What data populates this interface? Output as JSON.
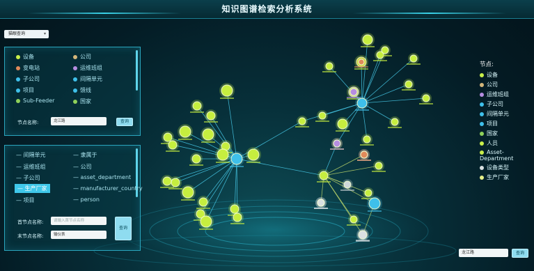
{
  "header": {
    "title": "知识图谱检索分析系统"
  },
  "mode_select": {
    "value": "猫眼查询"
  },
  "legend_panel": {
    "items": [
      {
        "label": "设备",
        "color": "#c9ef4a"
      },
      {
        "label": "公司",
        "color": "#d3b67a"
      },
      {
        "label": "变电站",
        "color": "#e08a5a"
      },
      {
        "label": "运维班组",
        "color": "#b58de0"
      },
      {
        "label": "子公司",
        "color": "#3fc0ea"
      },
      {
        "label": "间隔单元",
        "color": "#3fc0ea"
      },
      {
        "label": "项目",
        "color": "#3fc0ea"
      },
      {
        "label": "馈线",
        "color": "#3fc0ea"
      },
      {
        "label": "Sub-Feeder",
        "color": "#8fd15a"
      },
      {
        "label": "国家",
        "color": "#8fd15a"
      }
    ],
    "node_name_label": "节点名称:",
    "node_name_value": "龙江路",
    "query_button": "查询"
  },
  "relation_panel": {
    "items": [
      {
        "label": "间隔单元",
        "selected": false
      },
      {
        "label": "隶属于",
        "selected": false
      },
      {
        "label": "运维班组",
        "selected": false
      },
      {
        "label": "公司",
        "selected": false
      },
      {
        "label": "子公司",
        "selected": false
      },
      {
        "label": "asset_department",
        "selected": false
      },
      {
        "label": "生产厂家",
        "selected": true
      },
      {
        "label": "manufacturer_country",
        "selected": false
      },
      {
        "label": "项目",
        "selected": false
      },
      {
        "label": "person",
        "selected": false
      }
    ],
    "start_label": "首节点名称:",
    "start_placeholder": "请输入首节点名称",
    "end_label": "末节点名称:",
    "end_value": "输仪表",
    "query_button": "查询"
  },
  "right_legend": {
    "title": "节点:",
    "items": [
      {
        "label": "设备",
        "color": "#c9ef4a"
      },
      {
        "label": "公司",
        "color": "#d3b67a"
      },
      {
        "label": "运维班组",
        "color": "#b58de0"
      },
      {
        "label": "子公司",
        "color": "#3fc0ea"
      },
      {
        "label": "间隔单元",
        "color": "#3fc0ea"
      },
      {
        "label": "项目",
        "color": "#3fc0ea"
      },
      {
        "label": "国家",
        "color": "#8fd15a"
      },
      {
        "label": "人员",
        "color": "#c9ef4a"
      },
      {
        "label": "Asset-Department",
        "color": "#c9ef4a"
      },
      {
        "label": "设备类型",
        "color": "#d9e0e2"
      },
      {
        "label": "生产厂家",
        "color": "#e6f08a"
      }
    ]
  },
  "bottom_search": {
    "value": "龙江路",
    "button": "查询"
  }
}
